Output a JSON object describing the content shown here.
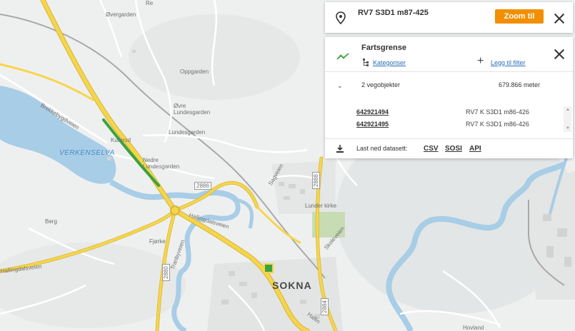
{
  "map": {
    "labels": {
      "re": "Re",
      "overgarden": "Øvergarden",
      "oppgarden": "Oppgarden",
      "ovre_lundesgarden": "Øvre\nLundesgarden",
      "lundesgarden": "Lundesgarden",
      "brekkebygdveien": "Brekkebygdveien",
      "kuferud": "Kuferud",
      "verkenselva": "VERKENSELVA",
      "nedre_lundesgarden": "Nedre\nLundesgarden",
      "road_2886": "2886",
      "sagveien": "Sagveien",
      "lunder_kirke": "Lunder kirke",
      "road_2888": "2888",
      "hallingdalsveien": "Hallingdalsveien",
      "berg": "Berg",
      "fjorke": "Fjørke",
      "tranbyveien": "Tranbyveien",
      "skoleveien": "Skoleveien",
      "hallingdalsveien2": "Hallingdalsveien",
      "road_2880": "2880",
      "sokna": "SOKNA",
      "road_2884": "2884",
      "hallin": "Hallin",
      "hovland": "Hovland"
    }
  },
  "selected_object": {
    "title": "RV7 S3D1 m87-425",
    "zoom_label": "Zoom til"
  },
  "filter_panel": {
    "title": "Fartsgrense",
    "categorize_label": "Kategoriser",
    "add_filter_label": "Legg til filter",
    "count_label": "2 vegobjekter",
    "length_label": "679.866 meter",
    "rows": [
      {
        "id": "642921494",
        "desc": "RV7 K S3D1 m86-426"
      },
      {
        "id": "642921495",
        "desc": "RV7 K S3D1 m86-426"
      }
    ],
    "download_label": "Last ned datasett:",
    "formats": [
      "CSV",
      "SOSI",
      "API"
    ]
  },
  "colors": {
    "accent_orange": "#f28f00",
    "link_blue": "#2a6eb8",
    "highlight_green": "#3ba33b",
    "road_yellow": "#f7d54a",
    "water_blue": "#a8cde6"
  }
}
